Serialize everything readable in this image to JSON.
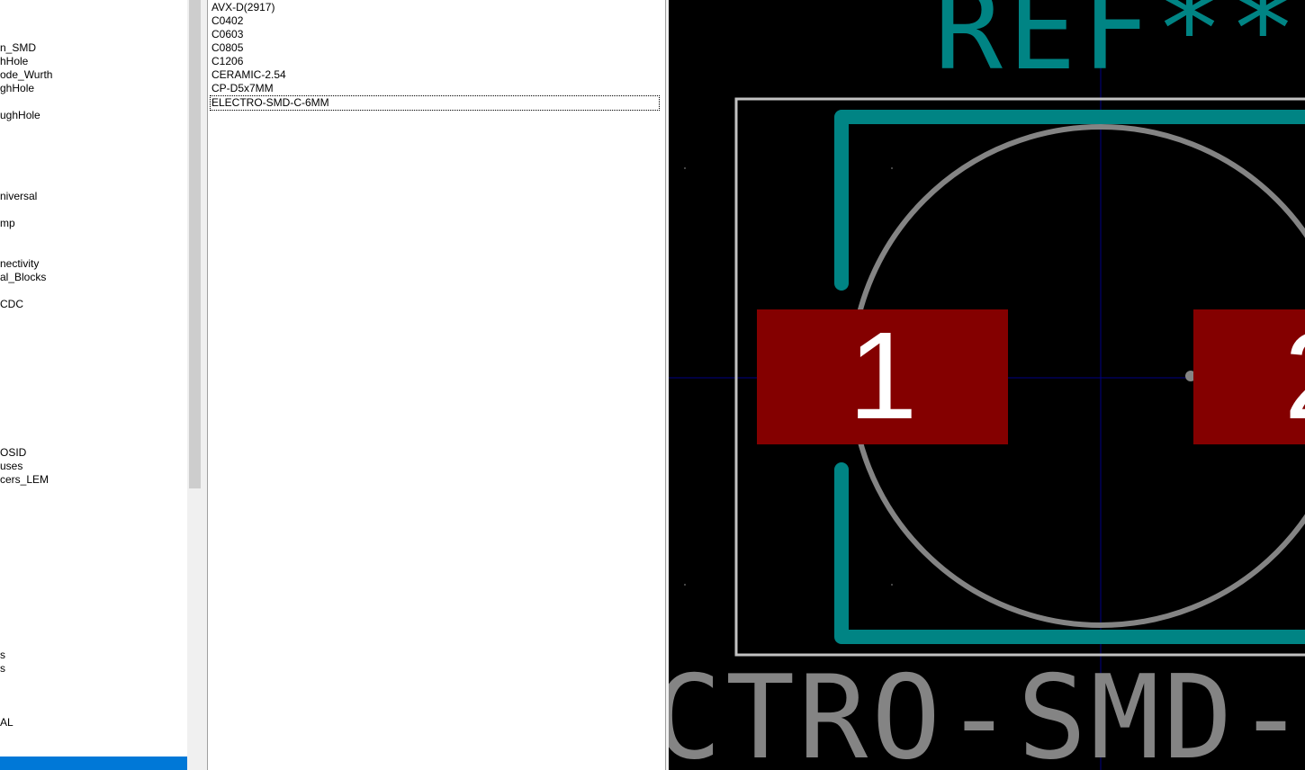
{
  "library_list": {
    "items": [
      {
        "label": "n_SMD"
      },
      {
        "label": "hHole"
      },
      {
        "label": "ode_Wurth"
      },
      {
        "label": "ghHole"
      },
      {
        "label": "ughHole"
      },
      {
        "label": "niversal"
      },
      {
        "label": "mp"
      },
      {
        "label": "nectivity"
      },
      {
        "label": "al_Blocks"
      },
      {
        "label": "CDC"
      },
      {
        "label": "OSID"
      },
      {
        "label": "uses"
      },
      {
        "label": "cers_LEM"
      },
      {
        "label": "s"
      },
      {
        "label": "s"
      },
      {
        "label": "AL"
      }
    ]
  },
  "footprint_list": {
    "items": [
      {
        "label": "AVX-D(2917)"
      },
      {
        "label": "C0402"
      },
      {
        "label": "C0603"
      },
      {
        "label": "C0805"
      },
      {
        "label": "C1206"
      },
      {
        "label": "CERAMIC-2.54"
      },
      {
        "label": "CP-D5x7MM"
      },
      {
        "label": "ELECTRO-SMD-C-6MM"
      }
    ],
    "selected_index": 7
  },
  "preview": {
    "reference_text": "REF**",
    "value_text": "CTRO-SMD-",
    "pads": [
      {
        "number": "1"
      },
      {
        "number": "2"
      }
    ],
    "colors": {
      "background": "#000000",
      "silkscreen": "#008484",
      "fab": "#848484",
      "courtyard": "#c2c2c2",
      "pad": "#840000",
      "pad_number": "#ffffff",
      "crosshair": "#000084"
    }
  }
}
